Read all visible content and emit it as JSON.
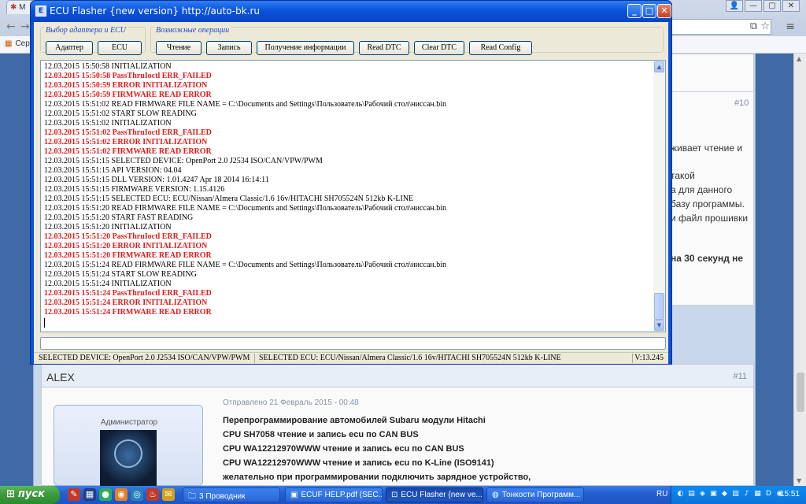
{
  "browser": {
    "tab_label": "M",
    "bookmark_label": "Серв",
    "window_controls": [
      "👤",
      "—",
      "▢",
      "✕"
    ]
  },
  "forum": {
    "post10_number": "#10",
    "post10_fragments": [
      "живает чтение и",
      "такой",
      "а для данного",
      " базу программы.",
      "и файл прошивки",
      "на 30 секунд не"
    ],
    "post11": {
      "author": "ALEX",
      "number": "#11",
      "role": "Администратор",
      "meta": "Отправлено 21 Февраль 2015 - 00:48",
      "lines": [
        "Перепрограммирование автомобилей Subaru модули Hitachi",
        "CPU SH7058 чтение и запись ecu по CAN BUS",
        "CPU WA12212970WWW  чтение и запись ecu по CAN BUS",
        "CPU WA12212970WWW чтение и запись ecu по K-Line (ISO9141)",
        "желательно при программировании подключить зарядное устройство,"
      ]
    }
  },
  "app": {
    "title": "ECU Flasher {new version}   http://auto-bk.ru",
    "groups": {
      "adapter_group_label": "Выбор адаптера и ECU",
      "ops_group_label": "Возможные операции"
    },
    "buttons": {
      "adapter": "Адаптер",
      "ecu": "ECU",
      "read": "Чтение",
      "write": "Запись",
      "get_info": "Получение информации",
      "read_dtc": "Read DTC",
      "clear_dtc": "Clear DTC",
      "read_config": "Read Config"
    },
    "log": [
      {
        "text": "12.03.2015 15:50:58 INITIALIZATION",
        "error": false
      },
      {
        "text": "12.03.2015 15:50:58 PassThruIoctl ERR_FAILED",
        "error": true
      },
      {
        "text": "12.03.2015 15:50:59 ERROR INITIALIZATION",
        "error": true
      },
      {
        "text": "12.03.2015 15:50:59 FIRMWARE READ ERROR",
        "error": true
      },
      {
        "text": "12.03.2015 15:51:02 READ FIRMWARE FILE NAME = C:\\Documents and Settings\\Пользователь\\Рабочий стол\\ниссан.bin",
        "error": false
      },
      {
        "text": "12.03.2015 15:51:02 START SLOW READING",
        "error": false
      },
      {
        "text": "12.03.2015 15:51:02 INITIALIZATION",
        "error": false
      },
      {
        "text": "12.03.2015 15:51:02 PassThruIoctl ERR_FAILED",
        "error": true
      },
      {
        "text": "12.03.2015 15:51:02 ERROR INITIALIZATION",
        "error": true
      },
      {
        "text": "12.03.2015 15:51:02 FIRMWARE READ ERROR",
        "error": true
      },
      {
        "text": "12.03.2015 15:51:15 SELECTED DEVICE: OpenPort 2.0 J2534 ISO/CAN/VPW/PWM",
        "error": false
      },
      {
        "text": "12.03.2015 15:51:15 API VERSION: 04.04",
        "error": false
      },
      {
        "text": "12.03.2015 15:51:15 DLL VERSION: 1.01.4247 Apr 18 2014 16:14:11",
        "error": false
      },
      {
        "text": "12.03.2015 15:51:15 FIRMWARE VERSION: 1.15.4126",
        "error": false
      },
      {
        "text": "12.03.2015 15:51:15 SELECTED ECU: ECU/Nissan/Almera Classic/1.6 16v/HITACHI SH705524N 512kb K-LINE",
        "error": false
      },
      {
        "text": "12.03.2015 15:51:20 READ FIRMWARE FILE NAME = C:\\Documents and Settings\\Пользователь\\Рабочий стол\\ниссан.bin",
        "error": false
      },
      {
        "text": "12.03.2015 15:51:20 START FAST READING",
        "error": false
      },
      {
        "text": "12.03.2015 15:51:20 INITIALIZATION",
        "error": false
      },
      {
        "text": "12.03.2015 15:51:20 PassThruIoctl ERR_FAILED",
        "error": true
      },
      {
        "text": "12.03.2015 15:51:20 ERROR INITIALIZATION",
        "error": true
      },
      {
        "text": "12.03.2015 15:51:20 FIRMWARE READ ERROR",
        "error": true
      },
      {
        "text": "12.03.2015 15:51:24 READ FIRMWARE FILE NAME = C:\\Documents and Settings\\Пользователь\\Рабочий стол\\ниссан.bin",
        "error": false
      },
      {
        "text": "12.03.2015 15:51:24 START SLOW READING",
        "error": false
      },
      {
        "text": "12.03.2015 15:51:24 INITIALIZATION",
        "error": false
      },
      {
        "text": "12.03.2015 15:51:24 PassThruIoctl ERR_FAILED",
        "error": true
      },
      {
        "text": "12.03.2015 15:51:24 ERROR INITIALIZATION",
        "error": true
      },
      {
        "text": "12.03.2015 15:51:24 FIRMWARE READ ERROR",
        "error": true
      }
    ],
    "input_value": "",
    "status": {
      "device": "SELECTED DEVICE: OpenPort 2.0 J2534 ISO/CAN/VPW/PWM",
      "ecu": "SELECTED ECU: ECU/Nissan/Almera Classic/1.6 16v/HITACHI SH705524N 512kb K-LINE",
      "version": "V:13.245"
    },
    "colors": {
      "error_text": "#e01c1c",
      "titlebar": "#0a54dc"
    }
  },
  "taskbar": {
    "start_label": "пуск",
    "tasks": [
      {
        "label": "3 Проводник",
        "icon": "folder-icon"
      },
      {
        "label": "ECUF HELP.pdf (SEC...",
        "icon": "pdf-icon"
      },
      {
        "label": "ECU Flasher {new ve...",
        "icon": "ecu-app-icon"
      },
      {
        "label": "Тонкости Программ...",
        "icon": "chrome-icon"
      }
    ],
    "lang": "RU",
    "clock": "15:51"
  }
}
